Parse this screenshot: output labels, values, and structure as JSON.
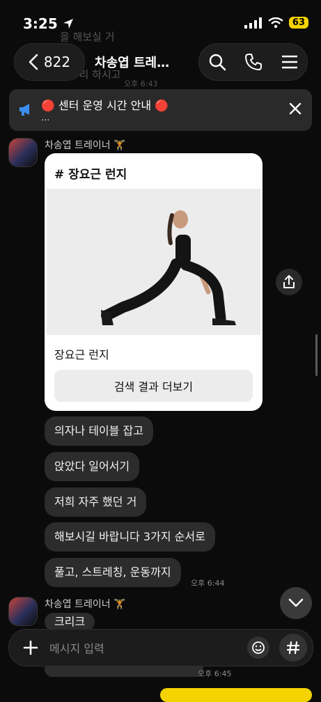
{
  "status": {
    "time": "3:25",
    "battery": "63"
  },
  "header": {
    "back_count": "822",
    "title": "차송엽 트레…"
  },
  "bg_ghost": {
    "line1": "을 해보실 거",
    "line2": "마무리 하시고",
    "time": "오후 6:43"
  },
  "notice": {
    "emoji": "🔴",
    "title": "센터 운영 시간 안내",
    "more": "..."
  },
  "group1": {
    "sender": "차송엽 트레이너",
    "card": {
      "tag": "# 장요근 런지",
      "caption": "장요근 런지",
      "button": "검색 결과 더보기"
    },
    "messages": [
      "의자나 테이블 잡고",
      "앉았다 일어서기",
      "저희 자주 했던 거",
      "해보시길 바랍니다 3가지 순서로",
      "풀고, 스트레칭, 운동까지"
    ],
    "time": "오후 6:44"
  },
  "group2": {
    "sender": "차송엽 트레이너",
    "first_message": "크리크",
    "time": "오후 6:45"
  },
  "input": {
    "placeholder": "메시지 입력"
  },
  "colors": {
    "background": "#0b0b0b",
    "bubble": "#2c2c2c",
    "battery": "#f5d300",
    "notice_icon": "#3b8ef0"
  }
}
